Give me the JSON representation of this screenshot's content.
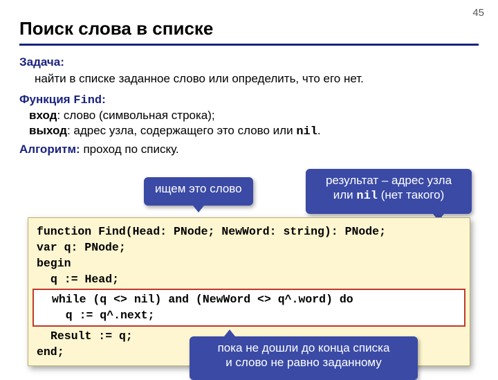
{
  "page_number": "45",
  "title": "Поиск слова в списке",
  "task_label": "Задача:",
  "task_text": "найти в списке заданное слово или определить, что его нет.",
  "func_label_prefix": "Функция ",
  "func_name": "Find",
  "func_label_colon": ":",
  "func_input_label": "вход",
  "func_input_text": ":   слово (символьная строка);",
  "func_output_label": "выход",
  "func_output_text_1": ": адрес узла, содержащего это слово или ",
  "func_output_nil": "nil",
  "func_output_text_2": ".",
  "algo_label": "Алгоритм:",
  "algo_text": " проход по списку.",
  "callout_search": "ищем это слово",
  "callout_result_l1": "результат – адрес узла",
  "callout_result_l2_a": "или ",
  "callout_result_l2_nil": "nil",
  "callout_result_l2_b": " (нет такого)",
  "callout_bottom_l1": "пока не дошли до конца списка",
  "callout_bottom_l2": "и слово не равно заданному",
  "code": {
    "l1": "function Find(Head: PNode; NewWord: string): PNode;",
    "l2": "var q: PNode;",
    "l3": "begin",
    "l4": "q := Head;",
    "l5": "while (q <> nil) and (NewWord <> q^.word) do",
    "l6": "  q := q^.next;",
    "l7": "Result := q;",
    "l8": "end;"
  }
}
